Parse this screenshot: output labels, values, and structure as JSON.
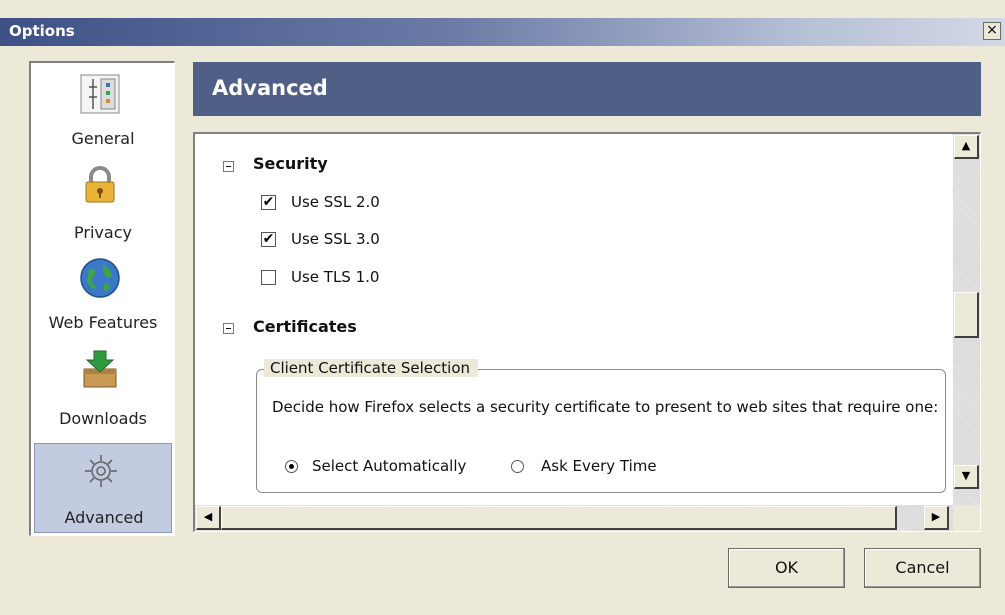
{
  "window": {
    "title": "Options",
    "close_label": "×"
  },
  "sidebar": {
    "items": [
      {
        "label": "General",
        "icon": "general-settings-icon"
      },
      {
        "label": "Privacy",
        "icon": "padlock-icon"
      },
      {
        "label": "Web Features",
        "icon": "globe-icon"
      },
      {
        "label": "Downloads",
        "icon": "download-box-icon"
      },
      {
        "label": "Advanced",
        "icon": "gears-icon",
        "selected": true
      }
    ]
  },
  "header": {
    "title": "Advanced"
  },
  "sections": {
    "security": {
      "title": "Security",
      "options": [
        {
          "label": "Use SSL 2.0",
          "checked": true,
          "mark": "✔"
        },
        {
          "label": "Use SSL 3.0",
          "checked": true,
          "mark": "✔"
        },
        {
          "label": "Use TLS 1.0",
          "checked": false,
          "mark": ""
        }
      ]
    },
    "certificates": {
      "title": "Certificates",
      "group_title": "Client Certificate Selection",
      "description": "Decide how Firefox selects a security certificate to present to web sites that require one:",
      "radios": [
        {
          "label": "Select Automatically",
          "selected": true
        },
        {
          "label": "Ask Every Time",
          "selected": false
        }
      ]
    }
  },
  "scrollbars": {
    "up": "▲",
    "down": "▼",
    "left": "◀",
    "right": "▶"
  },
  "buttons": {
    "ok": "OK",
    "cancel": "Cancel"
  },
  "colors": {
    "header_bg": "#4f5f85",
    "selected_pane_bg": "#c3cbe0",
    "dialog_bg": "#ece9d8"
  }
}
